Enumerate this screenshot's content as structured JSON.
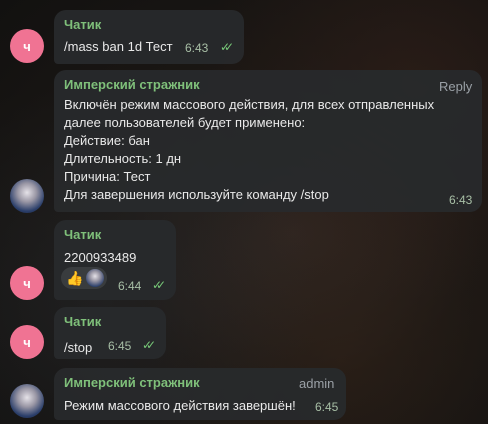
{
  "messages": [
    {
      "sender": "Чатик",
      "avatar_letter": "ч",
      "text_parts": [
        "/mass",
        " ban 1d Тест"
      ],
      "time": "6:43"
    },
    {
      "sender": "Имперский стражник",
      "reply_label": "Reply",
      "lines": [
        "Включён режим массового действия, для всех отправленных",
        "далее пользователей будет применено:",
        "Действие: бан",
        "Длительность: 1 дн",
        "Причина: Тест"
      ],
      "last_line_prefix": "Для завершения используйте команду ",
      "last_line_cmd": "/stop",
      "time": "6:43"
    },
    {
      "sender": "Чатик",
      "avatar_letter": "ч",
      "text": "2200933489",
      "reaction_icon": "thumbs-up",
      "time": "6:44"
    },
    {
      "sender": "Чатик",
      "avatar_letter": "ч",
      "text": "/stop",
      "time": "6:45"
    },
    {
      "sender": "Имперский стражник",
      "role": "admin",
      "text": "Режим массового действия завершён!",
      "time": "6:45"
    }
  ],
  "colors": {
    "sender": "#7fc07a",
    "bubble": "#282a2c",
    "avatar_letter_bg": "#f07393",
    "checks": "#77c878"
  }
}
